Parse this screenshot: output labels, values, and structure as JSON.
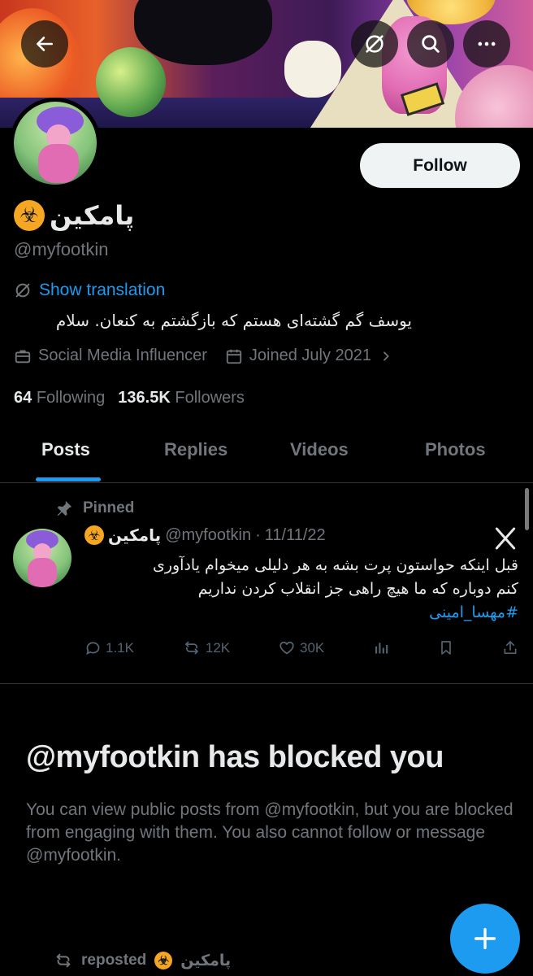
{
  "header": {
    "back_icon": "arrow-left-icon",
    "grok_icon": "grok-icon",
    "search_icon": "search-icon",
    "more_icon": "more-horizontal-icon"
  },
  "profile": {
    "display_name": "پامکین",
    "name_emoji": "☣",
    "handle": "@myfootkin",
    "follow_label": "Follow",
    "show_translation": "Show translation",
    "bio": "یوسف گم گشته‌ای هستم که بازگشتم به کنعان. سلام",
    "category": "Social Media Influencer",
    "joined": "Joined July 2021",
    "following_count": "64",
    "following_label": "Following",
    "followers_count": "136.5K",
    "followers_label": "Followers"
  },
  "tabs": [
    {
      "label": "Posts",
      "active": true
    },
    {
      "label": "Replies",
      "active": false
    },
    {
      "label": "Videos",
      "active": false
    },
    {
      "label": "Photos",
      "active": false
    }
  ],
  "pinned_post": {
    "pinned_label": "Pinned",
    "author_name": "پامکین",
    "author_handle": "@myfootkin",
    "separator": "·",
    "date": "11/11/22",
    "text_line1": "قبل اینکه حواستون پرت بشه به هر دلیلی میخوام یادآوری",
    "text_line2": "کنم دوباره که ما هیچ راهی جز انقلاب کردن نداریم",
    "hashtag": "#مهسا_امینی",
    "replies": "1.1K",
    "reposts": "12K",
    "likes": "30K"
  },
  "blocked": {
    "title": "@myfootkin has blocked you",
    "body": "You can view public posts from @myfootkin, but you are blocked from engaging with them. You also cannot follow or message @myfootkin."
  },
  "repost": {
    "label": "reposted",
    "name": "پامکین"
  },
  "colors": {
    "accent": "#1d9bf0",
    "background": "#000000",
    "text_primary": "#e7e9ea",
    "text_secondary": "#71767b",
    "hazard_badge": "#f5a623"
  }
}
